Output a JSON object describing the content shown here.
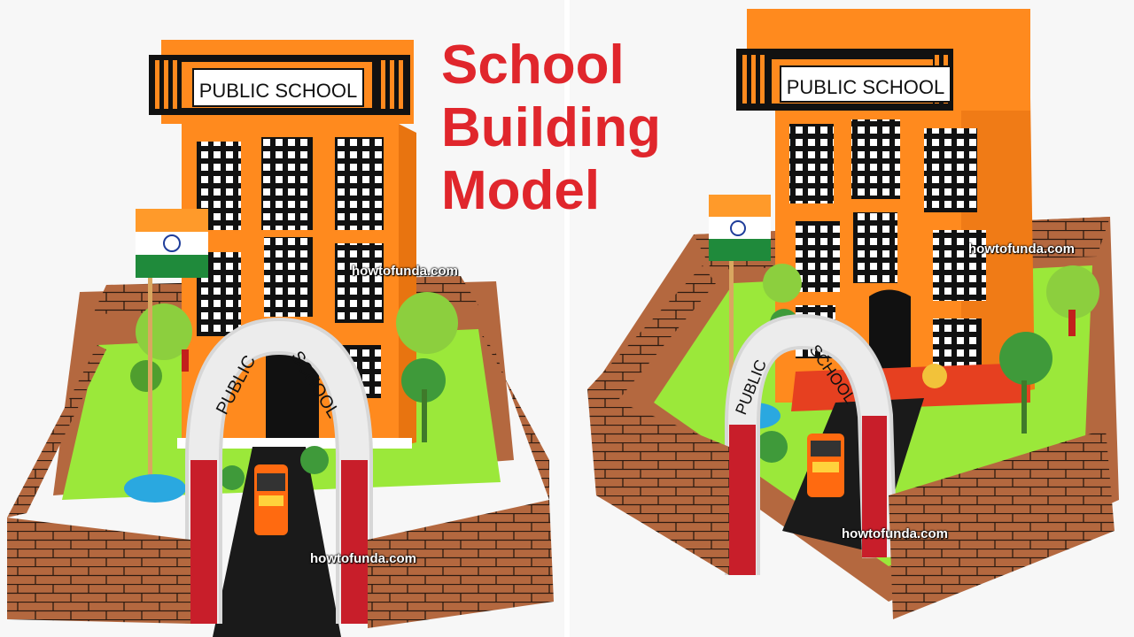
{
  "title": {
    "line1": "School",
    "line2": "Building",
    "line3": "Model"
  },
  "building_sign": "PUBLIC SCHOOL",
  "arch_sign": {
    "left": "PUBLIC",
    "right": "SCHOOL"
  },
  "watermarks": {
    "left_top": "howtofunda.com",
    "left_bottom": "howtofunda.com",
    "right_top": "howtofunda.com",
    "right_bottom": "howtofunda.com"
  },
  "colors": {
    "title_red": "#e0262c",
    "building_orange": "#ff8a1e",
    "brick_brown": "#b4683f",
    "lawn_green": "#9be83a"
  }
}
